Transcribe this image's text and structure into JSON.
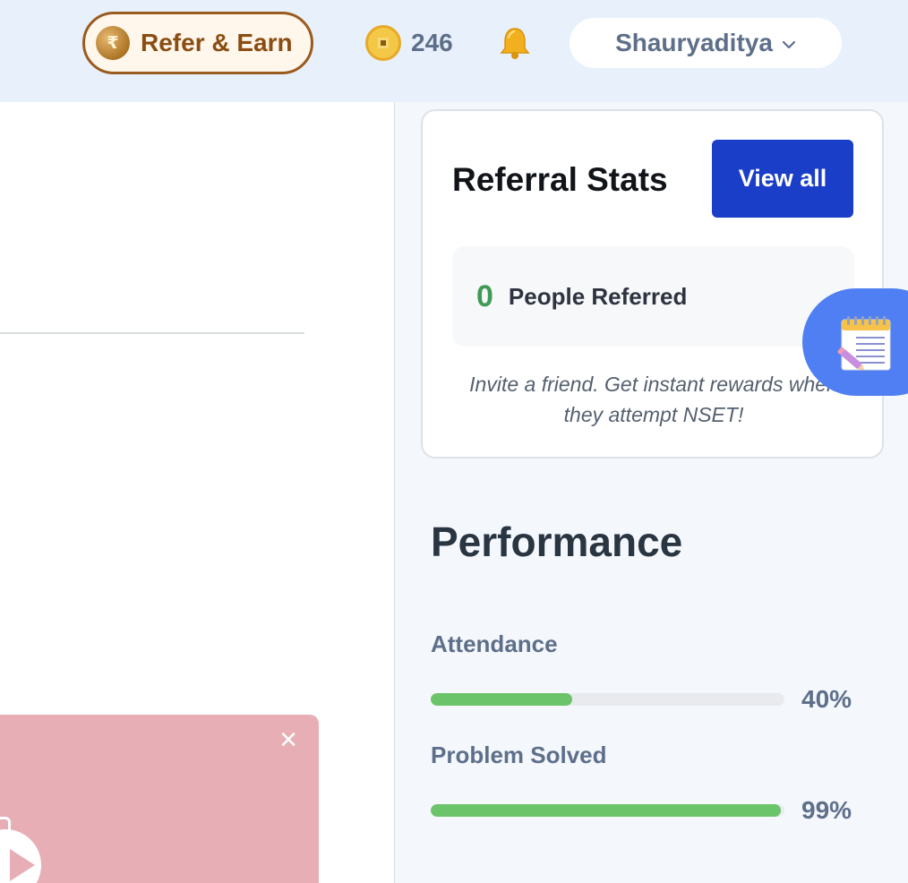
{
  "header": {
    "refer_label": "Refer & Earn",
    "rupee_symbol": "₹",
    "coin_count": "246",
    "username": "Shauryaditya",
    "icons": [
      "rupee-coin-icon",
      "coin-icon",
      "bell-icon",
      "chevron-down-icon"
    ]
  },
  "referral": {
    "title": "Referral Stats",
    "view_all_label": "View all",
    "count": "0",
    "count_label": "People Referred",
    "note": "Invite a friend. Get instant rewards when they attempt NSET!"
  },
  "performance": {
    "title": "Performance",
    "metrics": [
      {
        "label": "Attendance",
        "percent": 40,
        "display": "40%"
      },
      {
        "label": "Problem Solved",
        "percent": 99,
        "display": "99%"
      }
    ]
  },
  "promo": {
    "close_symbol": "×"
  },
  "colors": {
    "accent_blue": "#1a3ec8",
    "progress_green": "#6cc46a",
    "referral_count_green": "#3f9a56",
    "refer_brown": "#8a4d12",
    "promo_pink": "#e8aeb6",
    "fab_blue": "#4f7ff2"
  }
}
